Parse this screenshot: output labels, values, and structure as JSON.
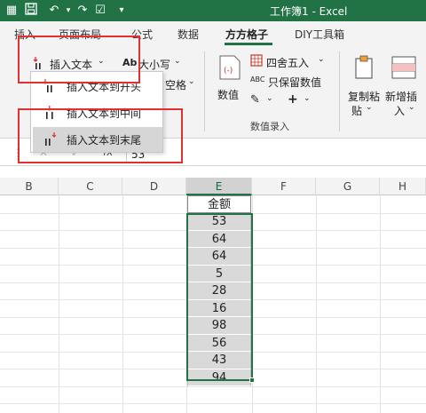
{
  "titlebar": {
    "title": "工作簿1 - Excel",
    "accent": "#217346"
  },
  "tabs": [
    "插入",
    "页面布局",
    "公式",
    "数据",
    "方方格子",
    "DIY工具箱"
  ],
  "active_tab": "方方格子",
  "ribbon": {
    "insert_text_label": "插入文本",
    "case_label": "大小写",
    "space_label": "空格",
    "value_label": "数值",
    "round_label": "四舍五入",
    "keep_numeric_label": "只保留数值",
    "numeric_entry_group": "数值录入",
    "copy_paste_label_1": "复制粘",
    "copy_paste_label_2": "贴",
    "new_insert_label_1": "新增插",
    "new_insert_label_2": "入",
    "plus_label": "+"
  },
  "dropdown": {
    "items": [
      {
        "label": "插入文本到开头"
      },
      {
        "label": "插入文本到中间"
      },
      {
        "label": "插入文本到末尾"
      }
    ],
    "highlighted_index": 2
  },
  "formula_bar": {
    "value": "53",
    "fx": "fx"
  },
  "columns": [
    "B",
    "C",
    "D",
    "E",
    "F",
    "G",
    "H"
  ],
  "selected_column": "E",
  "sheet": {
    "header": "金额",
    "values": [
      "53",
      "64",
      "64",
      "5",
      "28",
      "16",
      "98",
      "56",
      "43",
      "94"
    ]
  }
}
